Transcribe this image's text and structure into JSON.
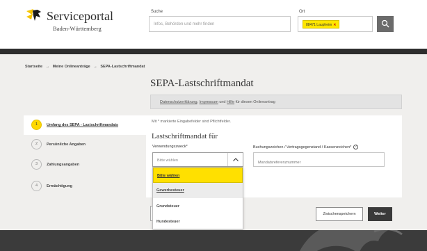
{
  "header": {
    "brand_title": "Serviceportal",
    "brand_subtitle": "Baden-Württemberg",
    "search_label": "Suche",
    "search_placeholder": "Infos, Behörden und mehr finden",
    "ort_label": "Ort",
    "ort_chip": "88471 Laupheim",
    "ort_chip_remove": "✕"
  },
  "breadcrumb": {
    "items": [
      "Startseite",
      "Meine Onlineanträge",
      "SEPA-Lastschriftmandat"
    ],
    "separator": "→"
  },
  "page": {
    "title": "SEPA-Lastschriftmandat",
    "info_links": [
      "Datenschutzerklärung",
      "Impressum",
      "Hilfe"
    ],
    "info_join": "und",
    "info_suffix": "für diesen Onlineantrag"
  },
  "steps": [
    {
      "number": "1",
      "label": "Umfang des SEPA - Lastschriftmandats",
      "active": true
    },
    {
      "number": "2",
      "label": "Persönliche Angaben",
      "active": false
    },
    {
      "number": "3",
      "label": "Zahlungsangaben",
      "active": false
    },
    {
      "number": "4",
      "label": "Ermächtigung",
      "active": false
    }
  ],
  "form": {
    "required_note": "Mit * markierte Eingabefelder sind Pflichtfelder.",
    "heading": "Lastschriftmandat für",
    "purpose_label": "Verwendungszweck*",
    "purpose_value": "Bitte wählen",
    "reference_label": "Buchungszeichen / Vertragsgegenstand / Kassenzeichen*",
    "reference_help": "?",
    "reference_placeholder": "Mandatsreferenznummer"
  },
  "dropdown": {
    "options": [
      "Bitte wählen",
      "Gewerbesteuer",
      "Grundsteuer",
      "Hundesteuer"
    ],
    "selected_index": 0,
    "hover_index": 1
  },
  "actions": {
    "save_label": "Zwischenspeichern",
    "next_label": "Weiter"
  },
  "colors": {
    "accent_yellow": "#ffe000",
    "dark": "#3a3a3a",
    "background": "#f0efed"
  }
}
